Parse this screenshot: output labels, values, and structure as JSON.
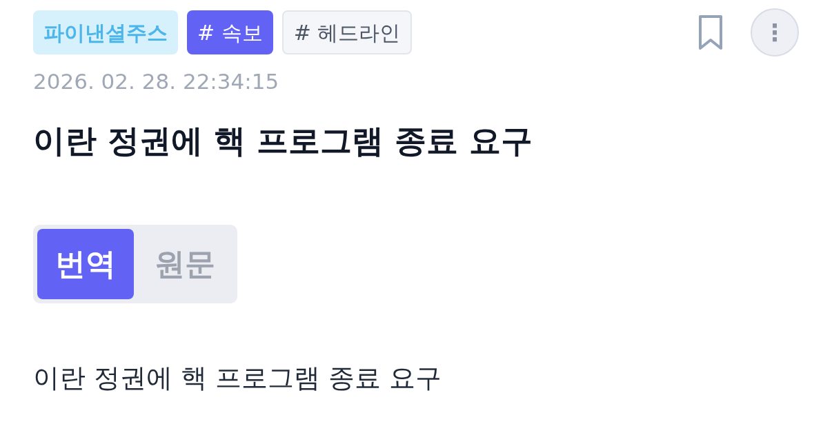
{
  "tags": [
    {
      "kind": "source",
      "label": "파이낸셜주스"
    },
    {
      "kind": "primary",
      "label": "# 속보"
    },
    {
      "kind": "outline",
      "label": "# 헤드라인"
    }
  ],
  "bookmarked": false,
  "more_button": {
    "label": "⋮"
  },
  "date": "2026. 02. 28. 22:34:15",
  "title": "이란 정권에 핵 프로그램 종료 요구",
  "segments": [
    {
      "label": "번역",
      "selected": true
    },
    {
      "label": "원문",
      "selected": false
    }
  ],
  "body": "이란 정권에 핵 프로그램 종료 요구"
}
